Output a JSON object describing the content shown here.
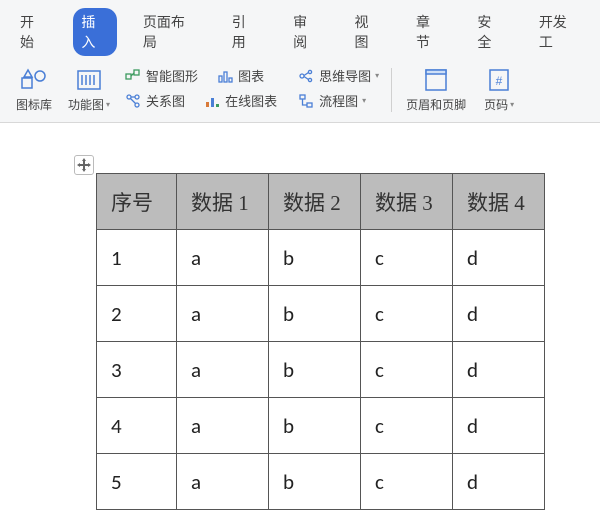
{
  "tabs": {
    "t0": "开始",
    "t1": "插入",
    "t2": "页面布局",
    "t3": "引用",
    "t4": "审阅",
    "t5": "视图",
    "t6": "章节",
    "t7": "安全",
    "t8": "开发工"
  },
  "toolbar": {
    "icon_lib": "图标库",
    "func_chart": "功能图",
    "smart_graphic": "智能图形",
    "chart": "图表",
    "relation_chart": "关系图",
    "online_chart": "在线图表",
    "mindmap": "思维导图",
    "flowchart": "流程图",
    "header_footer": "页眉和页脚",
    "page_number": "页码"
  },
  "table": {
    "headers": {
      "c0": "序号",
      "c1": "数据 1",
      "c2": "数据 2",
      "c3": "数据 3",
      "c4": "数据 4"
    },
    "rows": [
      {
        "c0": "1",
        "c1": "a",
        "c2": "b",
        "c3": "c",
        "c4": "d"
      },
      {
        "c0": "2",
        "c1": "a",
        "c2": "b",
        "c3": "c",
        "c4": "d"
      },
      {
        "c0": "3",
        "c1": "a",
        "c2": "b",
        "c3": "c",
        "c4": "d"
      },
      {
        "c0": "4",
        "c1": "a",
        "c2": "b",
        "c3": "c",
        "c4": "d"
      },
      {
        "c0": "5",
        "c1": "a",
        "c2": "b",
        "c3": "c",
        "c4": "d"
      }
    ]
  }
}
